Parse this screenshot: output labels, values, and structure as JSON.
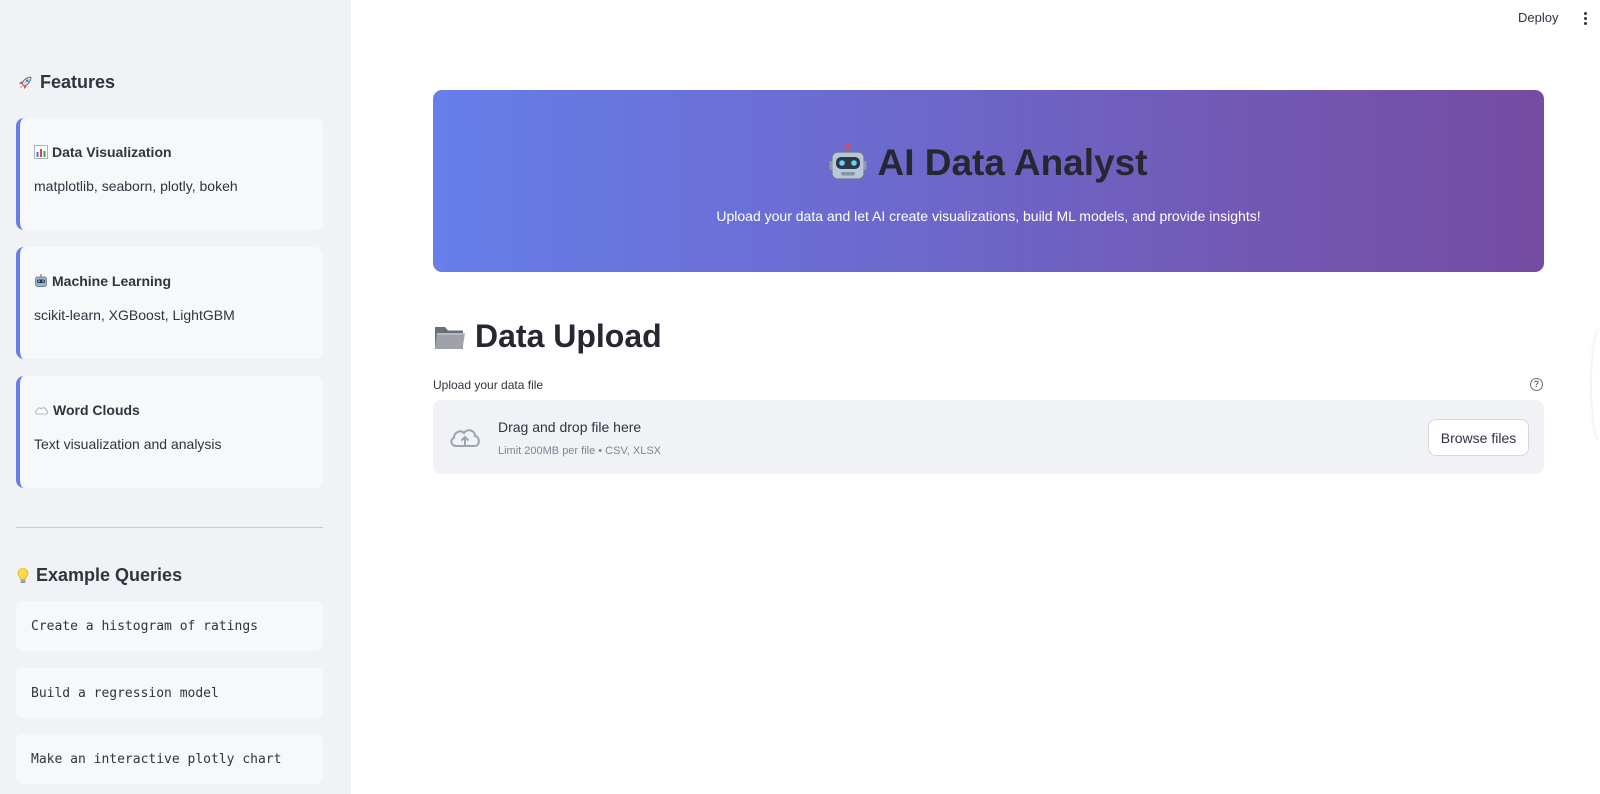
{
  "header": {
    "deploy_label": "Deploy",
    "menu_icon": "kebab-menu-icon"
  },
  "sidebar": {
    "features_heading": "Features",
    "features_icon": "rocket-icon",
    "features": [
      {
        "icon": "bar-chart-icon",
        "title": "Data Visualization",
        "desc": "matplotlib, seaborn, plotly, bokeh"
      },
      {
        "icon": "robot-icon",
        "title": "Machine Learning",
        "desc": "scikit-learn, XGBoost, LightGBM"
      },
      {
        "icon": "cloud-icon",
        "title": "Word Clouds",
        "desc": "Text visualization and analysis"
      }
    ],
    "examples_heading": "Example Queries",
    "examples_icon": "lightbulb-icon",
    "examples": [
      "Create a histogram of ratings",
      "Build a regression model",
      "Make an interactive plotly chart"
    ]
  },
  "hero": {
    "icon": "robot-icon",
    "title": "AI Data Analyst",
    "subtitle": "Upload your data and let AI create visualizations, build ML models, and provide insights!",
    "gradient_start": "#667eea",
    "gradient_end": "#764ba2"
  },
  "upload": {
    "section_icon": "folder-icon",
    "section_title": "Data Upload",
    "label": "Upload your data file",
    "help_icon": "question-circle-icon",
    "drop_text": "Drag and drop file here",
    "limit_text": "Limit 200MB per file • CSV, XLSX",
    "browse_label": "Browse files"
  }
}
